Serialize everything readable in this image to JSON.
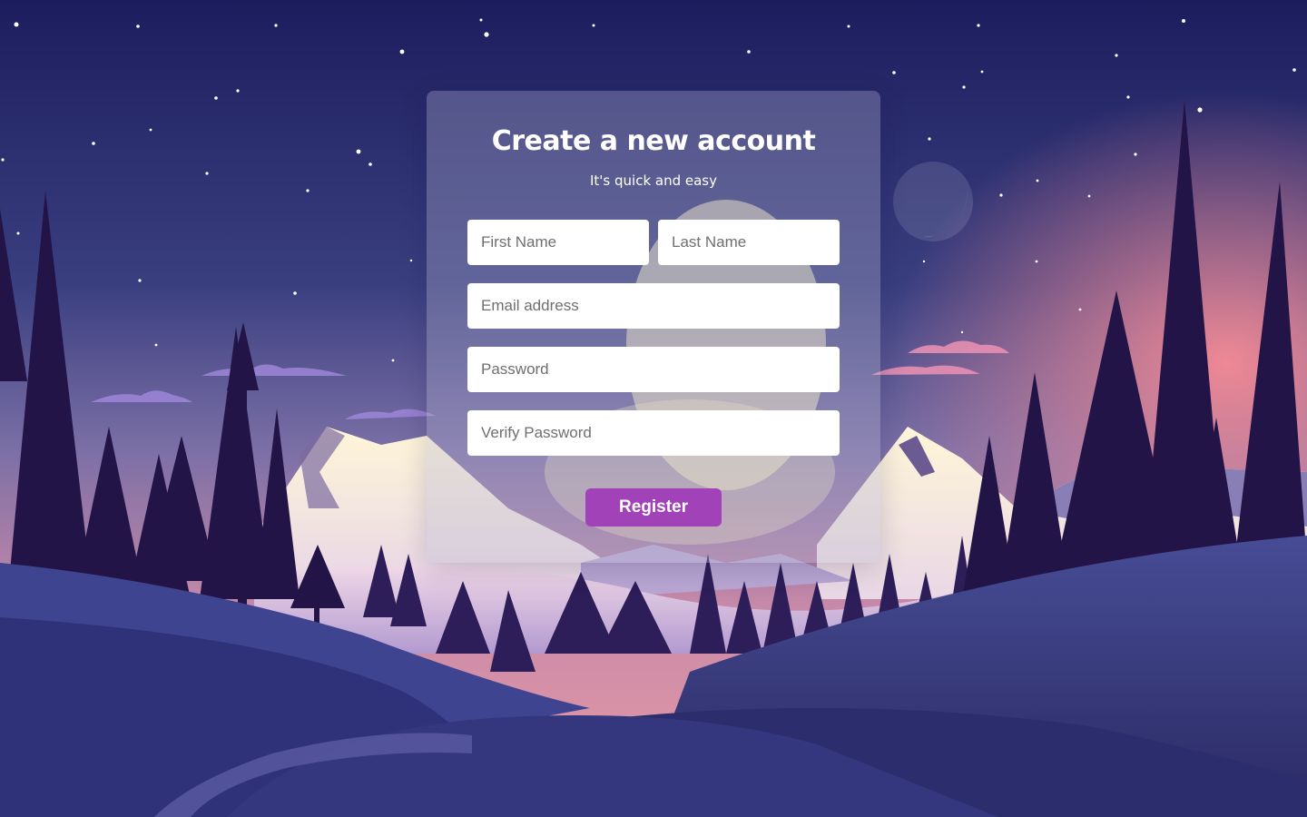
{
  "form": {
    "title": "Create a new account",
    "subtitle": "It's quick and easy",
    "first_name_placeholder": "First Name",
    "last_name_placeholder": "Last Name",
    "email_placeholder": "Email address",
    "password_placeholder": "Password",
    "verify_password_placeholder": "Verify Password",
    "register_label": "Register"
  },
  "colors": {
    "accent": "#a242b8",
    "sky_top": "#1d1e5c",
    "sky_bottom": "#f08f9d",
    "tree_dark": "#221447"
  }
}
